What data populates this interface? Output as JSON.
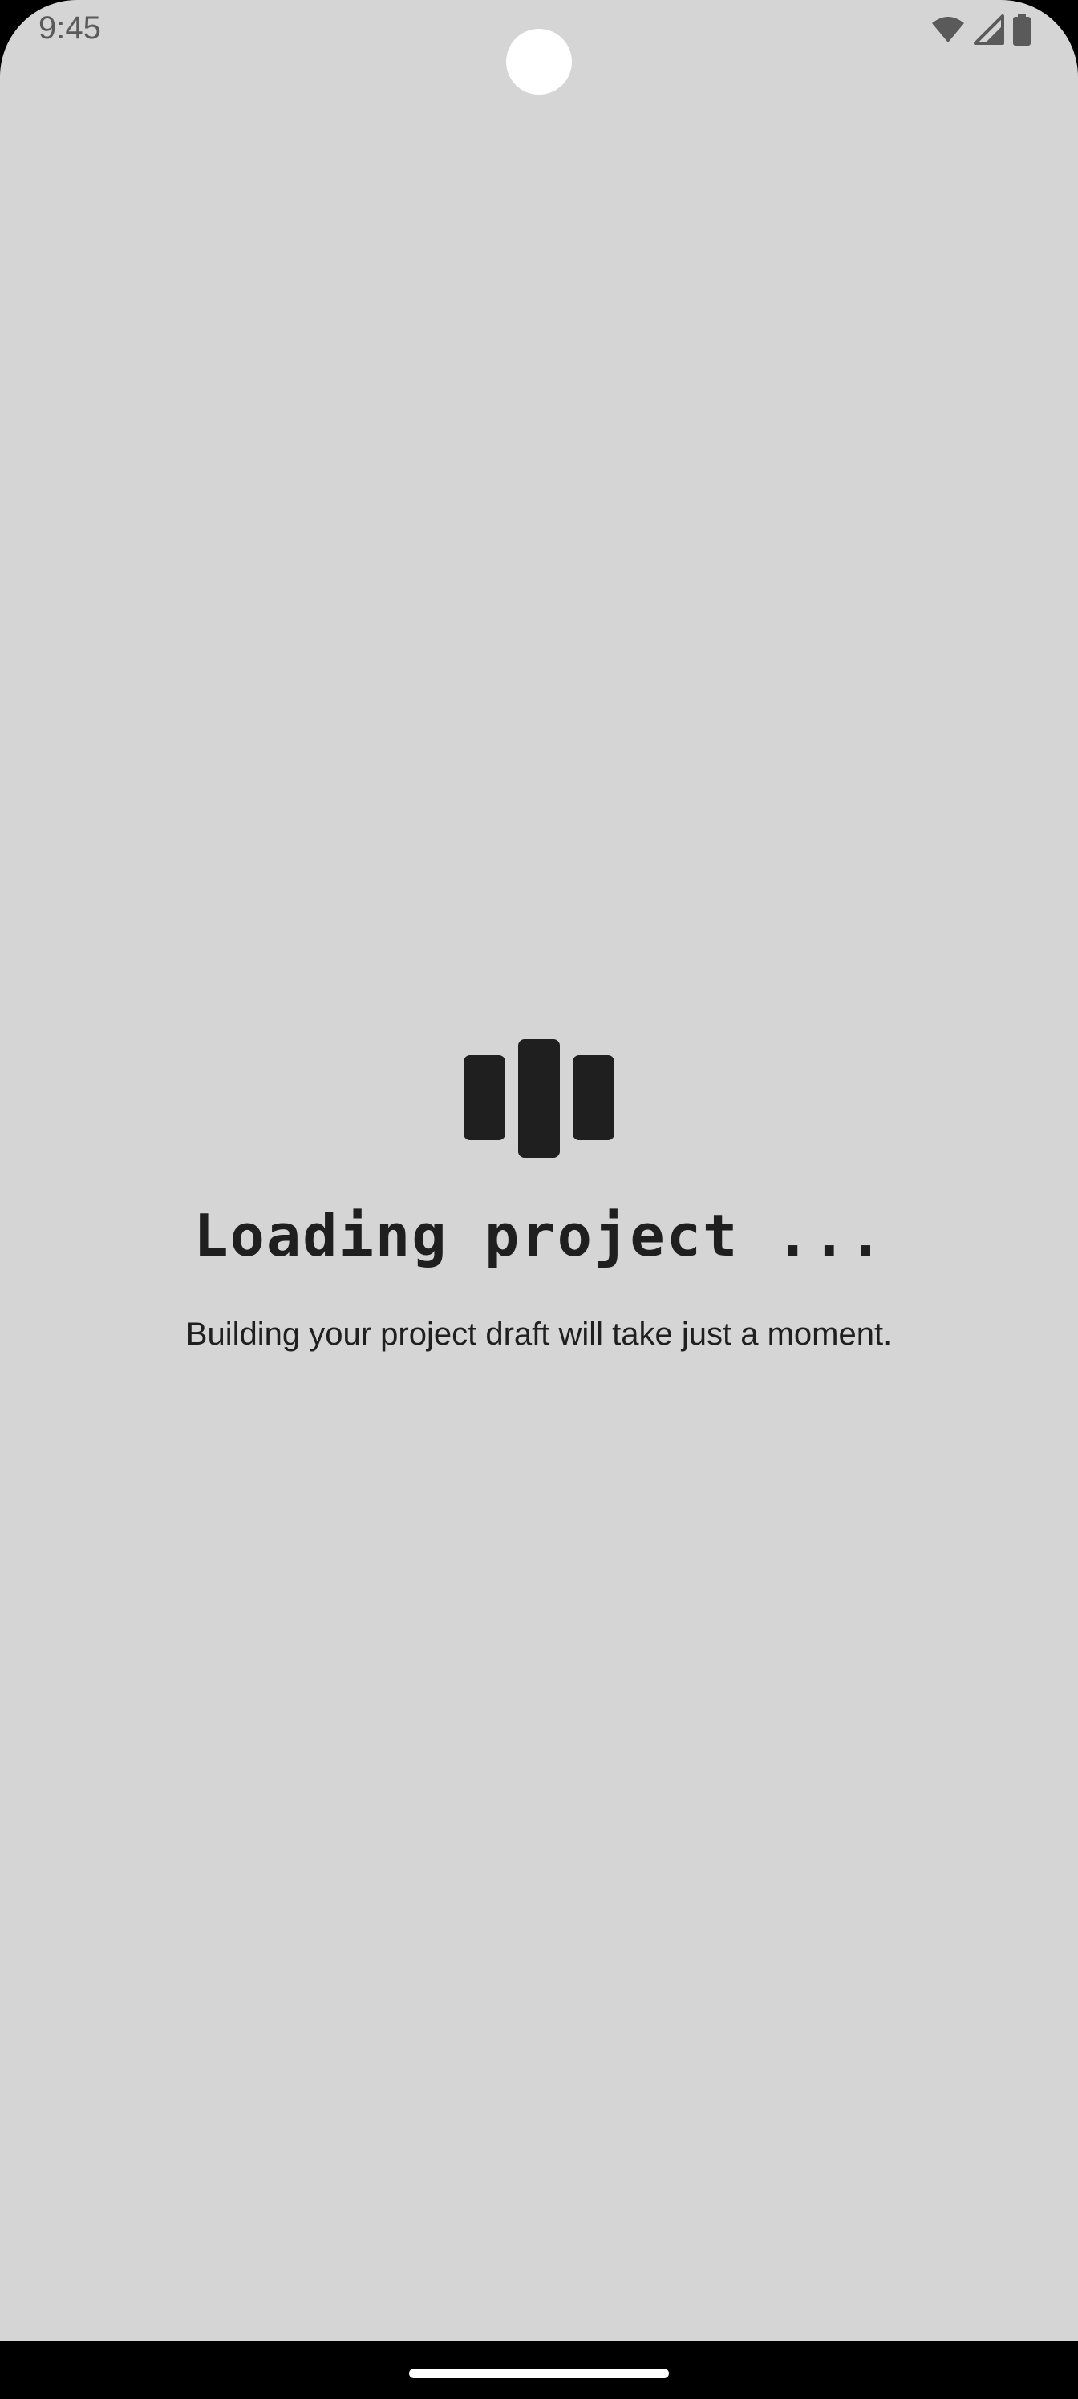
{
  "status_bar": {
    "time": "9:45",
    "icons": [
      "wifi-icon",
      "cellular-signal-icon",
      "battery-icon"
    ]
  },
  "loading": {
    "logo_icon": "app-logo-bars-icon",
    "title": "Loading project ...",
    "subtitle": "Building your project draft will take just a moment."
  },
  "colors": {
    "background": "#d5d5d5",
    "text": "#1f1f1f",
    "status_text": "#5a5a5a",
    "navigation_bar": "#000000"
  }
}
